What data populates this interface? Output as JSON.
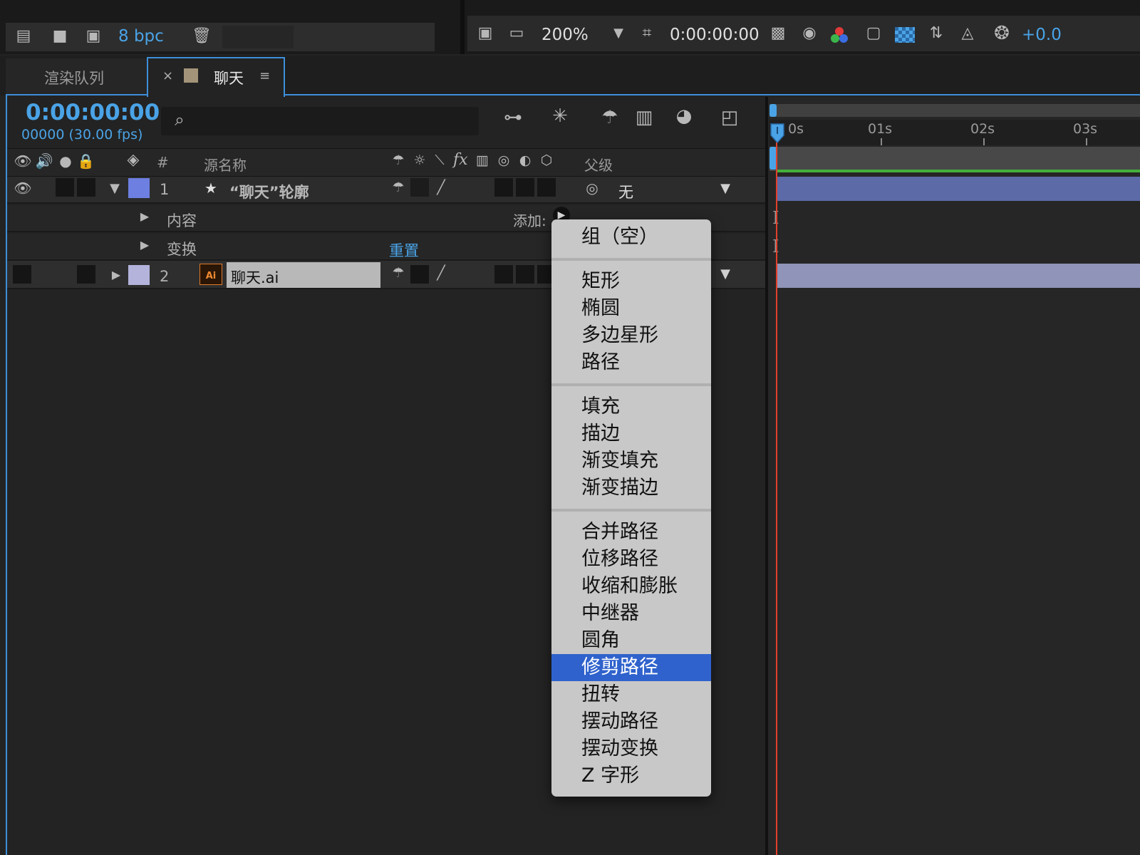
{
  "project_bar": {
    "bpc": "8 bpc"
  },
  "viewer_bar": {
    "zoom": "200%",
    "timecode": "0:00:00:00",
    "exposure": "+0.0"
  },
  "tabs": [
    {
      "label": "渲染队列"
    },
    {
      "label": "聊天",
      "close": "×",
      "menu": "≡",
      "swatch": "#a39479"
    }
  ],
  "timeline_panel": {
    "timecode": "0:00:00:00",
    "frames": "00000 (30.00 fps)",
    "columns": {
      "hash": "#",
      "source_name": "源名称",
      "parent": "父级"
    },
    "layers": [
      {
        "number": "1",
        "name": "“聊天”轮廓",
        "label_color": "#6d7fe0",
        "parent": "无",
        "expanded": true
      },
      {
        "number": "2",
        "name": "聊天.ai",
        "label_color": "#b3b3db",
        "expanded": false
      }
    ],
    "sub_rows": {
      "contents": "内容",
      "transform": "变换",
      "reset": "重置",
      "add": "添加:"
    }
  },
  "ruler": {
    "ticks": [
      "0s",
      "01s",
      "02s",
      "03s"
    ]
  },
  "context_menu": {
    "groups": [
      [
        "组（空）"
      ],
      [
        "矩形",
        "椭圆",
        "多边星形",
        "路径"
      ],
      [
        "填充",
        "描边",
        "渐变填充",
        "渐变描边"
      ],
      [
        "合并路径",
        "位移路径",
        "收缩和膨胀",
        "中继器",
        "圆角",
        "修剪路径",
        "扭转",
        "摆动路径",
        "摆动变换",
        "Z 字形"
      ]
    ],
    "selected": "修剪路径"
  },
  "colors": {
    "accent": "#3d8fd9",
    "layer1_bar": "#5c6aa8",
    "layer2_bar": "#9094b8",
    "playhead": "#e2412c",
    "menu_highlight": "#2f62cc"
  }
}
